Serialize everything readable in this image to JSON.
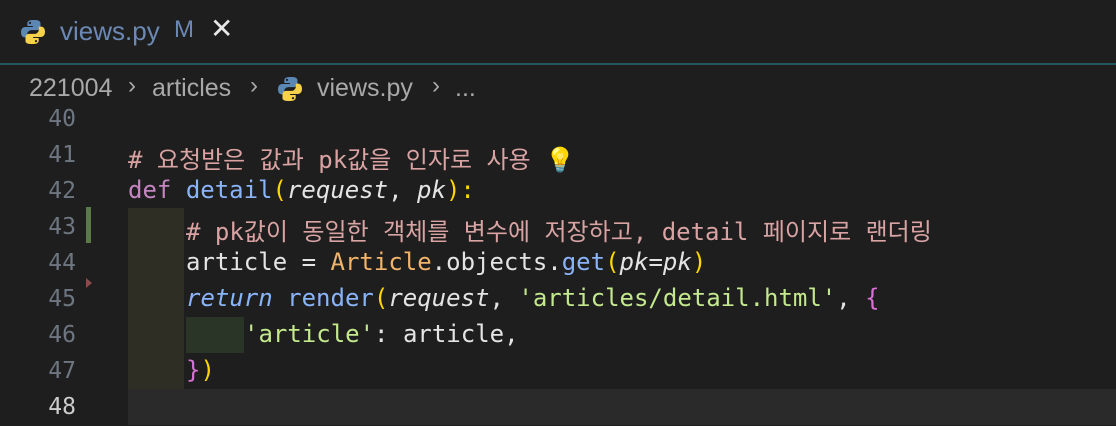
{
  "tab": {
    "title": "views.py",
    "modified_badge": "M",
    "close_glyph": "✕",
    "icon": "python-icon"
  },
  "breadcrumb": {
    "items": [
      "221004",
      "articles",
      "views.py",
      "..."
    ],
    "separator": "›"
  },
  "editor": {
    "line_numbers": [
      "40",
      "41",
      "42",
      "43",
      "44",
      "45",
      "46",
      "47",
      "48"
    ],
    "active_line": "48",
    "lines": {
      "l41": {
        "comment": "# 요청받은 값과 pk값을 인자로 사용",
        "bulb": "💡"
      },
      "l42": {
        "kw": "def",
        "fn": "detail",
        "p1": "request",
        "comma": ", ",
        "p2": "pk",
        "close": "):"
      },
      "l43": {
        "comment": "# pk값이 동일한 객체를 변수에 저장하고, detail 페이지로 랜더링"
      },
      "l44": {
        "var": "article",
        "eq": " = ",
        "cls": "Article",
        "dot1": ".",
        "objects": "objects",
        "dot2": ".",
        "get": "get",
        "open": "(",
        "kw": "pk",
        "assign": "=",
        "val": "pk",
        "close": ")"
      },
      "l45": {
        "ret": "return",
        "fn": "render",
        "open": "(",
        "p1": "request",
        "comma1": ", ",
        "str": "'articles/detail.html'",
        "comma2": ", ",
        "brace": "{"
      },
      "l46": {
        "key": "'article'",
        "colon": ": ",
        "val": "article",
        "comma": ","
      },
      "l47": {
        "brace": "}",
        "paren": ")"
      }
    }
  },
  "colors": {
    "background": "#1e1e1e",
    "comment": "#d9a3a3",
    "keyword": "#c586c0",
    "function": "#8ab4f8",
    "string": "#c3e88d",
    "class": "#f0b46a"
  }
}
